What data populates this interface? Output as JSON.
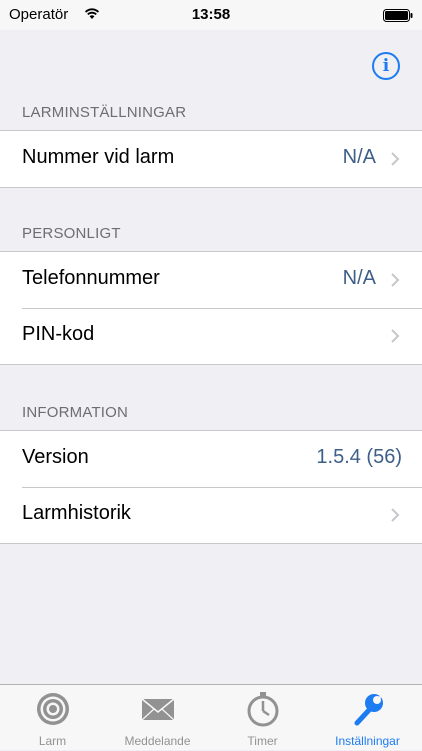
{
  "status_bar": {
    "carrier": "Operatör",
    "time": "13:58"
  },
  "nav": {
    "info_label": "i"
  },
  "sections": [
    {
      "header": "LARMINSTÄLLNINGAR",
      "rows": [
        {
          "label": "Nummer vid larm",
          "value": "N/A"
        }
      ]
    },
    {
      "header": "PERSONLIGT",
      "rows": [
        {
          "label": "Telefonnummer",
          "value": "N/A"
        },
        {
          "label": "PIN-kod",
          "value": ""
        }
      ]
    },
    {
      "header": "INFORMATION",
      "rows": [
        {
          "label": "Version",
          "value": "1.5.4 (56)"
        },
        {
          "label": "Larmhistorik",
          "value": ""
        }
      ]
    }
  ],
  "tabs": [
    {
      "label": "Larm",
      "icon": "target-icon"
    },
    {
      "label": "Meddelande",
      "icon": "envelope-icon"
    },
    {
      "label": "Timer",
      "icon": "stopwatch-icon"
    },
    {
      "label": "Inställningar",
      "icon": "wrench-icon",
      "active": true
    }
  ],
  "colors": {
    "accent": "#1d7cf2",
    "value_text": "#3e5f89",
    "background": "#efeff4",
    "inactive_tab": "#929292"
  }
}
